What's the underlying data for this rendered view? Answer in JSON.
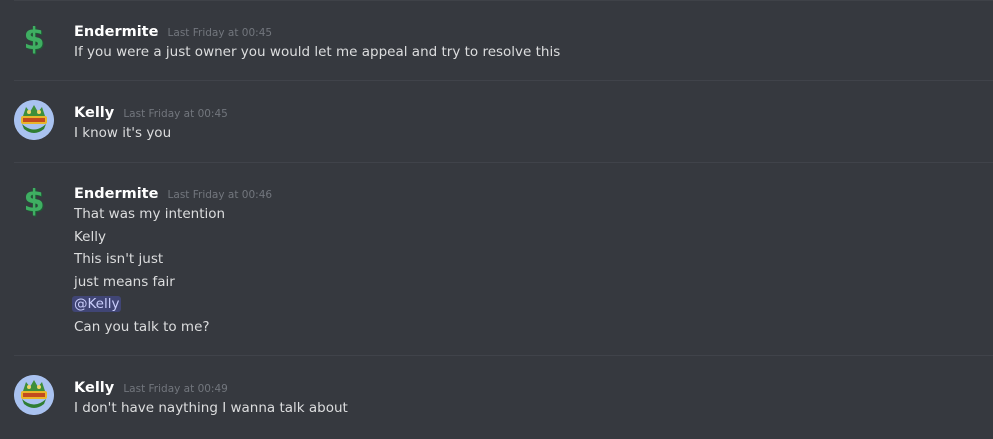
{
  "messages": [
    {
      "username": "Endermite",
      "timestamp": "Last Friday at 00:45",
      "avatar": "dollar-sign-icon",
      "lines": [
        "If you were a just owner you would let me appeal and try to resolve this"
      ]
    },
    {
      "username": "Kelly",
      "timestamp": "Last Friday at 00:45",
      "avatar": "kelly-server-logo",
      "lines": [
        "I know it's you"
      ]
    },
    {
      "username": "Endermite",
      "timestamp": "Last Friday at 00:46",
      "avatar": "dollar-sign-icon",
      "lines": [
        "That was my intention",
        "Kelly",
        "This isn't just",
        "just means fair",
        "@Kelly",
        "Can you talk to me?"
      ]
    },
    {
      "username": "Kelly",
      "timestamp": "Last Friday at 00:49",
      "avatar": "kelly-server-logo",
      "lines": [
        "I don't have naything I wanna talk about"
      ]
    }
  ],
  "avatar_glyphs": {
    "dollar": "$"
  },
  "colors": {
    "background": "#36393f",
    "username": "#ffffff",
    "timestamp": "#72767d",
    "text": "#dcddde",
    "mention_bg": "#4a4f83",
    "mention_text": "#c9cdfb",
    "dollar_green": "#3fae62"
  }
}
